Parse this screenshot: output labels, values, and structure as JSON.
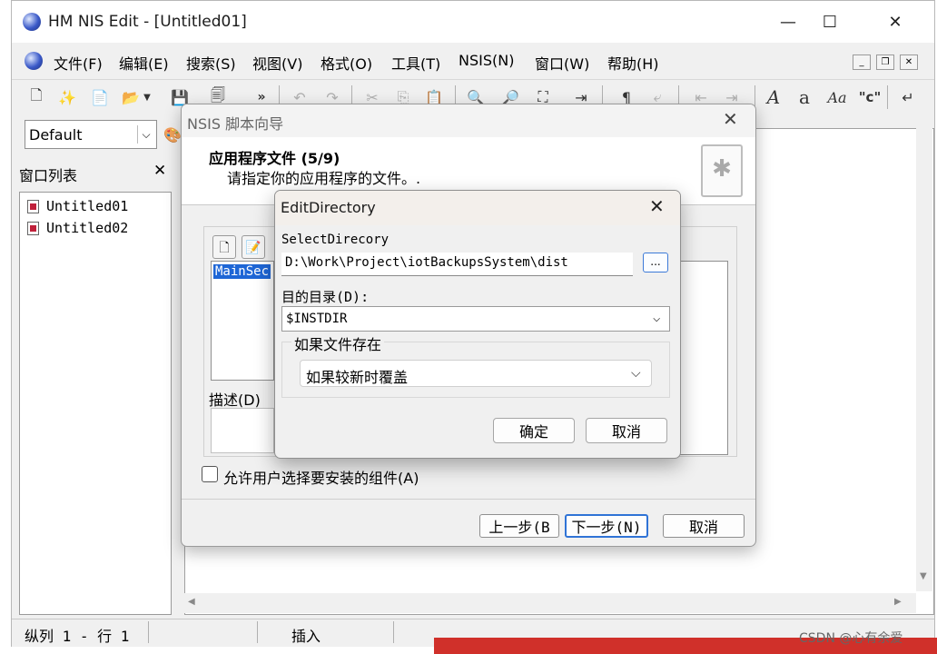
{
  "main_window": {
    "title": "HM NIS Edit - [Untitled01]",
    "controls": {
      "minimize": "—",
      "maximize": "☐",
      "close": "✕"
    }
  },
  "menubar": {
    "items": [
      {
        "label": "文件(F)"
      },
      {
        "label": "编辑(E)"
      },
      {
        "label": "搜索(S)"
      },
      {
        "label": "视图(V)"
      },
      {
        "label": "格式(O)"
      },
      {
        "label": "工具(T)"
      },
      {
        "label": "NSIS(N)"
      },
      {
        "label": "窗口(W)"
      },
      {
        "label": "帮助(H)"
      }
    ],
    "mdi": {
      "minimize": "_",
      "restore": "❐",
      "close": "✕"
    }
  },
  "toolbar": {
    "overflow": "»",
    "font_a": "A",
    "font_small_a": "a",
    "font_aa": "Aa",
    "quote": "\"c\""
  },
  "format_bar": {
    "scheme": "Default"
  },
  "window_list": {
    "title": "窗口列表",
    "close": "✕",
    "items": [
      {
        "label": "Untitled01"
      },
      {
        "label": "Untitled02"
      }
    ]
  },
  "statusbar": {
    "position": "纵列 1 - 行 1",
    "mode": "插入"
  },
  "watermark": "CSDN @心有余爱",
  "wizard": {
    "title": "NSIS 脚本向导",
    "close": "✕",
    "step_title": "应用程序文件 (5/9)",
    "step_desc": "请指定你的应用程序的文件。.",
    "list_item": "MainSec",
    "desc_label": "描述(D)",
    "allow_select_label": "允许用户选择要安装的组件(A)",
    "buttons": {
      "back": "上一步(B",
      "next": "下一步(N)",
      "cancel": "取消"
    }
  },
  "edit_directory": {
    "title": "EditDirectory",
    "close": "✕",
    "select_label": "SelectDirecory",
    "select_path": "D:\\Work\\Project\\iotBackupsSystem\\dist",
    "browse": "...",
    "dest_label": "目的目录(D):",
    "dest_value": "$INSTDIR",
    "group_label": "如果文件存在",
    "overwrite_value": "如果较新时覆盖",
    "ok": "确定",
    "cancel": "取消"
  }
}
